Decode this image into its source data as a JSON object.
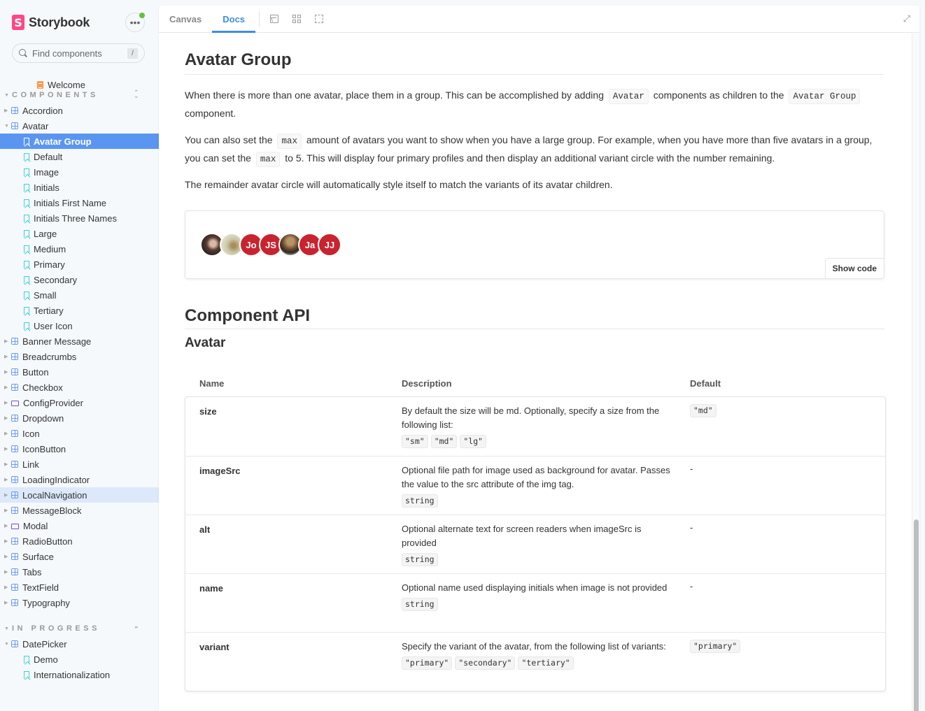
{
  "app": {
    "brand": "Storybook",
    "brand_logo_letter": "S",
    "menu_icon": "ellipsis-icon"
  },
  "search": {
    "placeholder": "Find components",
    "shortcut": "/"
  },
  "sidebar": {
    "welcome": "Welcome",
    "sections": [
      {
        "label": "COMPONENTS",
        "toggle_icon": "expand-all-icon",
        "items": [
          {
            "label": "Accordion",
            "type": "component",
            "expanded": false
          },
          {
            "label": "Avatar",
            "type": "component",
            "expanded": true,
            "stories": [
              "Avatar Group",
              "Default",
              "Image",
              "Initials",
              "Initials First Name",
              "Initials Three Names",
              "Large",
              "Medium",
              "Primary",
              "Secondary",
              "Small",
              "Tertiary",
              "User Icon"
            ]
          },
          {
            "label": "Banner Message",
            "type": "component"
          },
          {
            "label": "Breadcrumbs",
            "type": "component"
          },
          {
            "label": "Button",
            "type": "component"
          },
          {
            "label": "Checkbox",
            "type": "component"
          },
          {
            "label": "ConfigProvider",
            "type": "folder"
          },
          {
            "label": "Dropdown",
            "type": "component"
          },
          {
            "label": "Icon",
            "type": "component"
          },
          {
            "label": "IconButton",
            "type": "component"
          },
          {
            "label": "Link",
            "type": "component"
          },
          {
            "label": "LoadingIndicator",
            "type": "component"
          },
          {
            "label": "LocalNavigation",
            "type": "component"
          },
          {
            "label": "MessageBlock",
            "type": "component"
          },
          {
            "label": "Modal",
            "type": "folder"
          },
          {
            "label": "RadioButton",
            "type": "component"
          },
          {
            "label": "Surface",
            "type": "component"
          },
          {
            "label": "Tabs",
            "type": "component"
          },
          {
            "label": "TextField",
            "type": "component"
          },
          {
            "label": "Typography",
            "type": "component"
          }
        ]
      },
      {
        "label": "IN PROGRESS",
        "toggle_icon": "collapse-all-icon",
        "items": [
          {
            "label": "DatePicker",
            "type": "component",
            "expanded": true,
            "stories": [
              "Demo",
              "Internationalization"
            ]
          }
        ]
      }
    ],
    "selected": "Avatar Group",
    "hovered": "LocalNavigation"
  },
  "toolbar": {
    "tabs": [
      {
        "label": "Canvas",
        "active": false
      },
      {
        "label": "Docs",
        "active": true
      }
    ],
    "icons": [
      "image-icon",
      "grid-icon",
      "outline-icon"
    ],
    "expand_icon": "fullscreen-icon"
  },
  "doc": {
    "title": "Avatar Group",
    "p1": {
      "before": "When there is more than one avatar, place them in a group. This can be accomplished by adding ",
      "code1": "Avatar",
      "middle": " components as children to the ",
      "code2": "Avatar Group",
      "after": " component."
    },
    "p2": {
      "before": "You can also set the ",
      "code1": "max",
      "middle": " amount of avatars you want to show when you have a large group. For example, when you have more than five avatars in a group, you can set the ",
      "code2": "max",
      "after": " to 5. This will display four primary profiles and then display an additional variant circle with the number remaining."
    },
    "p3": "The remainder avatar circle will automatically style itself to match the variants of its avatar children.",
    "preview": {
      "avatars": [
        {
          "kind": "photo",
          "style": "photo1"
        },
        {
          "kind": "photo",
          "style": "photo2"
        },
        {
          "kind": "initials",
          "text": "Jo"
        },
        {
          "kind": "initials",
          "text": "JS"
        },
        {
          "kind": "photo",
          "style": "photo3"
        },
        {
          "kind": "initials",
          "text": "Ja"
        },
        {
          "kind": "initials",
          "text": "JJ"
        }
      ],
      "avatar_color": "#c8232f",
      "show_code": "Show code"
    },
    "api_title": "Component API",
    "api_subtitle": "Avatar",
    "api_headers": {
      "name": "Name",
      "description": "Description",
      "default": "Default"
    },
    "api_rows": [
      {
        "name": "size",
        "description": "By default the size will be md. Optionally, specify a size from the following list:",
        "chips": [
          "\"sm\"",
          "\"md\"",
          "\"lg\""
        ],
        "default": "\"md\"",
        "default_is_code": true
      },
      {
        "name": "imageSrc",
        "description": "Optional file path for image used as background for avatar. Passes the value to the src attribute of the img tag.",
        "chips": [
          "string"
        ],
        "default": "-",
        "default_is_code": false
      },
      {
        "name": "alt",
        "description": "Optional alternate text for screen readers when imageSrc is provided",
        "chips": [
          "string"
        ],
        "default": "-",
        "default_is_code": false
      },
      {
        "name": "name",
        "description": "Optional name used displaying initials when image is not provided",
        "chips": [
          "string"
        ],
        "default": "-",
        "default_is_code": false
      },
      {
        "name": "variant",
        "description": "Specify the variant of the avatar, from the following list of variants:",
        "chips": [
          "\"primary\"",
          "\"secondary\"",
          "\"tertiary\""
        ],
        "default": "\"primary\"",
        "default_is_code": true
      }
    ]
  },
  "colors": {
    "accent": "#3d8ce8",
    "selected_bg": "#5a96f1",
    "hover_bg": "#dde9fa",
    "brand": "#ff4785",
    "status_online": "#66bf3c"
  }
}
